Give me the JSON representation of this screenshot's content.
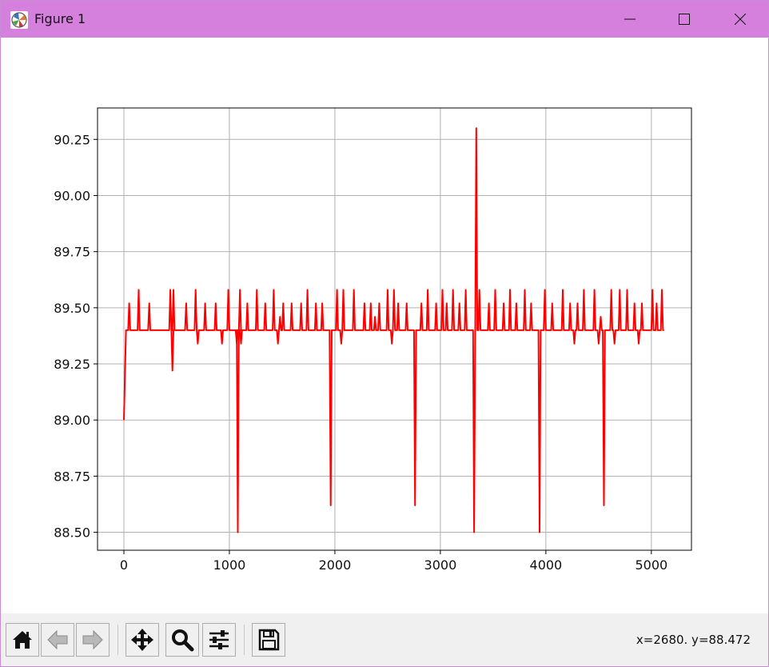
{
  "window": {
    "title": "Figure 1",
    "title_bar_color": "#d580dc"
  },
  "toolbar": {
    "buttons": [
      {
        "name": "home-button",
        "icon": "home-icon"
      },
      {
        "name": "back-button",
        "icon": "back-arrow-icon"
      },
      {
        "name": "forward-button",
        "icon": "forward-arrow-icon"
      },
      {
        "name": "pan-button",
        "icon": "move-icon"
      },
      {
        "name": "zoom-button",
        "icon": "magnifier-icon"
      },
      {
        "name": "configure-subplots-button",
        "icon": "sliders-icon"
      },
      {
        "name": "save-button",
        "icon": "floppy-disk-icon"
      }
    ],
    "coords": "x=2680. y=88.472"
  },
  "chart_data": {
    "type": "line",
    "title": "",
    "xlabel": "",
    "ylabel": "",
    "xlim": [
      -250,
      5380
    ],
    "ylim": [
      88.42,
      90.39
    ],
    "xticks": [
      0,
      1000,
      2000,
      3000,
      4000,
      5000
    ],
    "xtick_labels": [
      "0",
      "1000",
      "2000",
      "3000",
      "4000",
      "5000"
    ],
    "yticks": [
      88.5,
      88.75,
      89.0,
      89.25,
      89.5,
      89.75,
      90.0,
      90.25
    ],
    "ytick_labels": [
      "88.50",
      "88.75",
      "89.00",
      "89.25",
      "89.50",
      "89.75",
      "90.00",
      "90.25"
    ],
    "grid": true,
    "line_color": "#ff0000",
    "baseline": 89.4,
    "series": [
      {
        "color": "#ff0000",
        "start": [
          0,
          89.0
        ],
        "rise": [
          20,
          89.4
        ],
        "end": [
          5120,
          89.4
        ],
        "spikes": [
          [
            50,
            89.52
          ],
          [
            140,
            89.58
          ],
          [
            240,
            89.52
          ],
          [
            440,
            89.58
          ],
          [
            460,
            89.22
          ],
          [
            470,
            89.58
          ],
          [
            590,
            89.52
          ],
          [
            680,
            89.58
          ],
          [
            700,
            89.34
          ],
          [
            770,
            89.52
          ],
          [
            870,
            89.52
          ],
          [
            930,
            89.34
          ],
          [
            990,
            89.58
          ],
          [
            1070,
            89.34
          ],
          [
            1080,
            88.5
          ],
          [
            1100,
            89.58
          ],
          [
            1110,
            89.34
          ],
          [
            1170,
            89.52
          ],
          [
            1260,
            89.58
          ],
          [
            1340,
            89.52
          ],
          [
            1420,
            89.58
          ],
          [
            1460,
            89.34
          ],
          [
            1480,
            89.46
          ],
          [
            1510,
            89.52
          ],
          [
            1590,
            89.52
          ],
          [
            1680,
            89.52
          ],
          [
            1740,
            89.58
          ],
          [
            1820,
            89.52
          ],
          [
            1880,
            89.52
          ],
          [
            1960,
            88.62
          ],
          [
            2020,
            89.58
          ],
          [
            2060,
            89.34
          ],
          [
            2080,
            89.58
          ],
          [
            2180,
            89.58
          ],
          [
            2280,
            89.52
          ],
          [
            2340,
            89.52
          ],
          [
            2380,
            89.46
          ],
          [
            2420,
            89.52
          ],
          [
            2500,
            89.58
          ],
          [
            2540,
            89.34
          ],
          [
            2560,
            89.58
          ],
          [
            2600,
            89.52
          ],
          [
            2680,
            89.52
          ],
          [
            2760,
            88.62
          ],
          [
            2820,
            89.52
          ],
          [
            2880,
            89.58
          ],
          [
            2960,
            89.52
          ],
          [
            3020,
            89.58
          ],
          [
            3060,
            89.52
          ],
          [
            3120,
            89.58
          ],
          [
            3180,
            89.52
          ],
          [
            3240,
            89.58
          ],
          [
            3320,
            88.5
          ],
          [
            3340,
            90.3
          ],
          [
            3370,
            89.58
          ],
          [
            3460,
            89.52
          ],
          [
            3520,
            89.58
          ],
          [
            3600,
            89.52
          ],
          [
            3660,
            89.58
          ],
          [
            3720,
            89.52
          ],
          [
            3800,
            89.58
          ],
          [
            3860,
            89.52
          ],
          [
            3940,
            88.5
          ],
          [
            3990,
            89.58
          ],
          [
            4060,
            89.52
          ],
          [
            4160,
            89.58
          ],
          [
            4230,
            89.52
          ],
          [
            4270,
            89.34
          ],
          [
            4300,
            89.52
          ],
          [
            4360,
            89.58
          ],
          [
            4460,
            89.58
          ],
          [
            4500,
            89.34
          ],
          [
            4520,
            89.46
          ],
          [
            4550,
            88.62
          ],
          [
            4620,
            89.58
          ],
          [
            4650,
            89.34
          ],
          [
            4700,
            89.58
          ],
          [
            4770,
            89.58
          ],
          [
            4840,
            89.52
          ],
          [
            4880,
            89.34
          ],
          [
            4910,
            89.52
          ],
          [
            5010,
            89.58
          ],
          [
            5050,
            89.52
          ],
          [
            5100,
            89.58
          ]
        ]
      }
    ]
  }
}
